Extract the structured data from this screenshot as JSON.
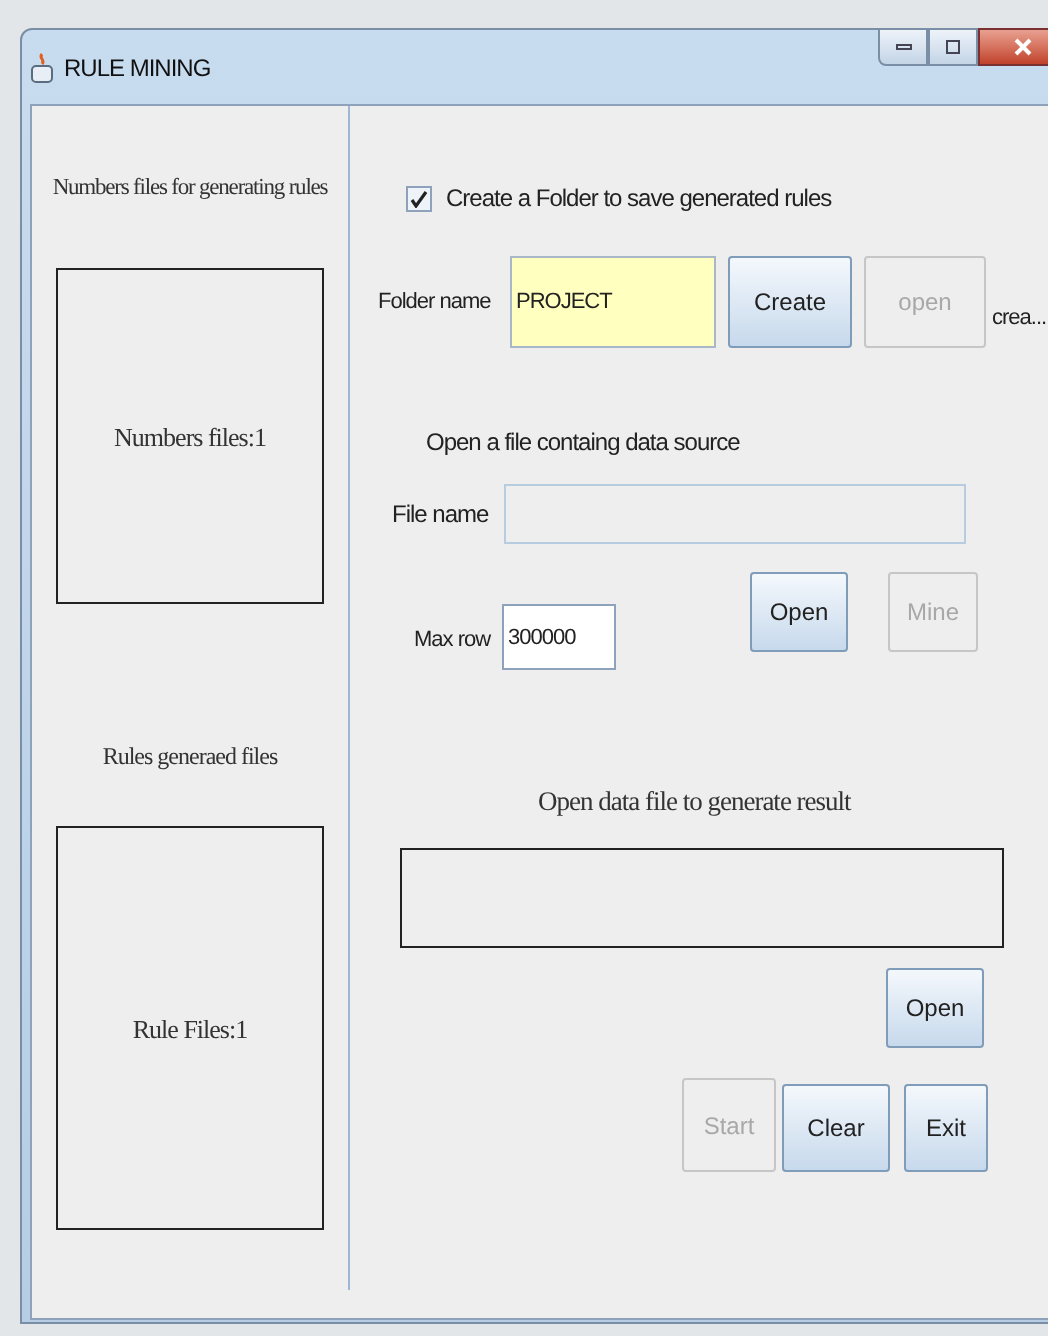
{
  "window": {
    "title": "RULE MINING"
  },
  "left_panel": {
    "numbers_heading": "Numbers files for generating rules",
    "numbers_box": "Numbers files:1",
    "rules_heading": "Rules generaed files",
    "rules_box": "Rule Files:1"
  },
  "create_folder": {
    "label": "Create  a Folder to save generated rules",
    "checked": true
  },
  "folder": {
    "label": "Folder name",
    "value": "PROJECT",
    "buttons": [
      {
        "label": "Create",
        "disabled": false
      },
      {
        "label": "open",
        "disabled": true
      }
    ],
    "status": "crea..."
  },
  "data_source": {
    "heading": "Open a file containg data source",
    "file_label": "File name",
    "max_row_label": "Max row",
    "max_row_value": "300000",
    "buttons": [
      {
        "label": "Open",
        "disabled": false
      },
      {
        "label": "Mine",
        "disabled": true
      }
    ]
  },
  "result": {
    "heading": "Open data file to generate result",
    "open_button": {
      "label": "Open",
      "disabled": false
    },
    "buttons": [
      {
        "label": "Start",
        "disabled": true
      },
      {
        "label": "Clear",
        "disabled": false
      },
      {
        "label": "Exit",
        "disabled": false
      }
    ]
  }
}
